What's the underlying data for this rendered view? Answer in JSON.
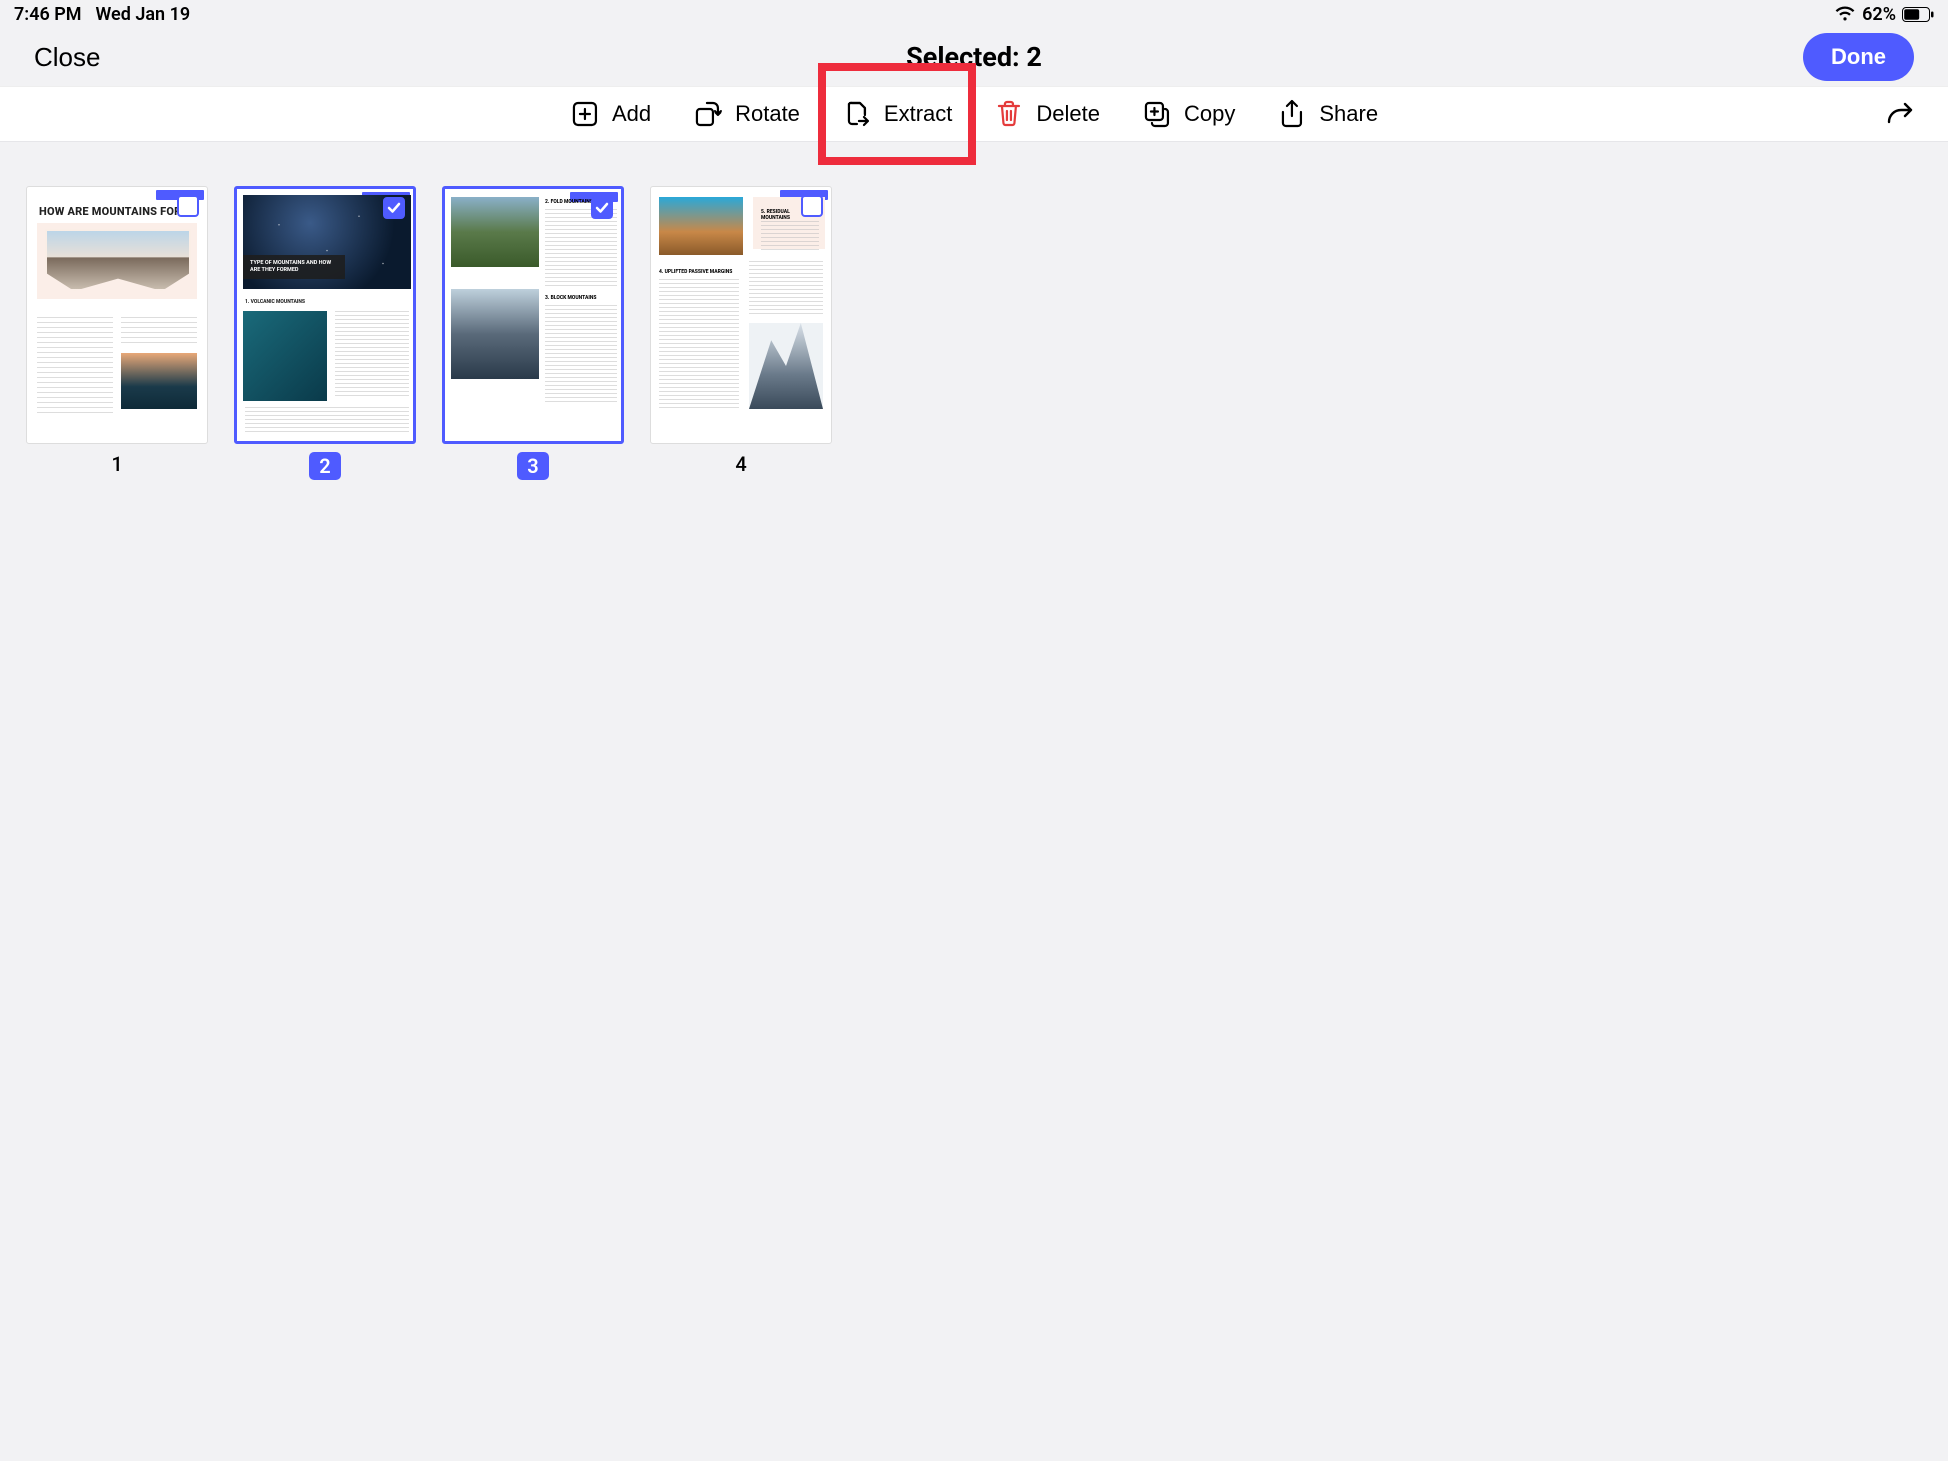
{
  "status_bar": {
    "time": "7:46 PM",
    "date": "Wed Jan 19",
    "battery_pct": "62%"
  },
  "header": {
    "close_label": "Close",
    "title": "Selected: 2",
    "done_label": "Done"
  },
  "toolbar": {
    "add": "Add",
    "rotate": "Rotate",
    "extract": "Extract",
    "delete": "Delete",
    "copy": "Copy",
    "share": "Share"
  },
  "highlighted_tool": "extract",
  "pages": [
    {
      "number": "1",
      "selected": false,
      "title": "HOW ARE MOUNTAINS FORM"
    },
    {
      "number": "2",
      "selected": true,
      "caption": "TYPE OF MOUNTAINS AND HOW ARE THEY FORMED",
      "sub": "1. VOLCANIC MOUNTAINS"
    },
    {
      "number": "3",
      "selected": true,
      "h1": "2. FOLD MOUNTAINS",
      "h2": "3. BLOCK MOUNTAINS"
    },
    {
      "number": "4",
      "selected": false,
      "h1": "5. RESIDUAL MOUNTAINS",
      "h2": "4. UPLIFTED PASSIVE MARGINS"
    }
  ]
}
